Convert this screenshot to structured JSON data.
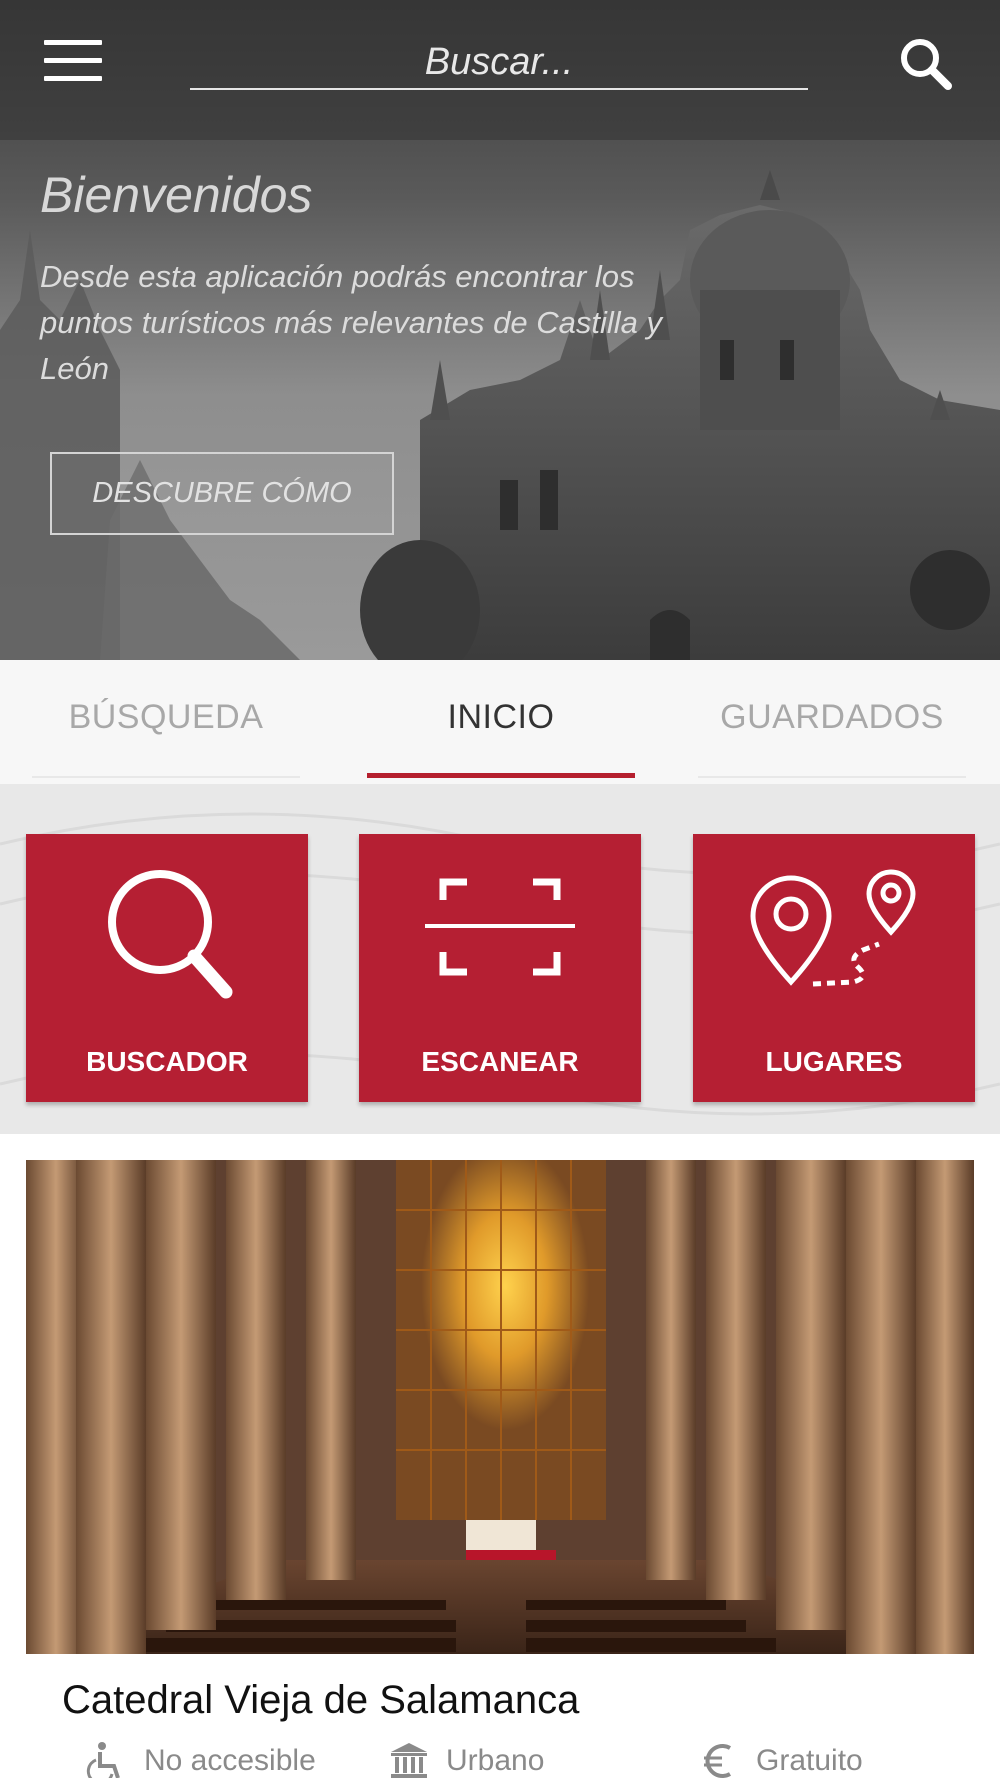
{
  "header": {
    "search_placeholder": "Buscar...",
    "menu_icon": "hamburger-menu-icon",
    "search_icon": "search-icon"
  },
  "hero": {
    "title": "Bienvenidos",
    "description": "Desde esta aplicación podrás encontrar los puntos turísticos más relevantes de Castilla y León",
    "button_label": "DESCUBRE CÓMO"
  },
  "tabs": [
    {
      "label": "BÚSQUEDA",
      "active": false
    },
    {
      "label": "INICIO",
      "active": true
    },
    {
      "label": "GUARDADOS",
      "active": false
    }
  ],
  "actions": [
    {
      "label": "BUSCADOR",
      "icon": "magnifier-icon"
    },
    {
      "label": "ESCANEAR",
      "icon": "scan-frame-icon"
    },
    {
      "label": "LUGARES",
      "icon": "map-pins-route-icon"
    }
  ],
  "place": {
    "title": "Catedral Vieja de Salamanca",
    "accessibility": "No accesible",
    "setting": "Urbano",
    "price": "Gratuito"
  },
  "colors": {
    "accent": "#b51f33",
    "header_bg": "#383838",
    "tabs_bg": "#f7f7f7"
  }
}
